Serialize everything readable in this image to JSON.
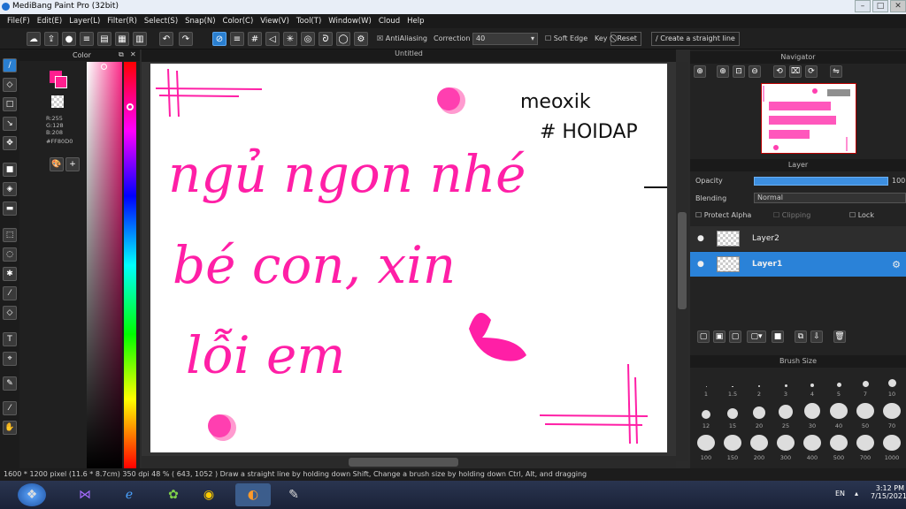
{
  "window": {
    "title": "MediBang Paint Pro (32bit)"
  },
  "menu": [
    "File(F)",
    "Edit(E)",
    "Layer(L)",
    "Filter(R)",
    "Select(S)",
    "Snap(N)",
    "Color(C)",
    "View(V)",
    "Tool(T)",
    "Window(W)",
    "Cloud",
    "Help"
  ],
  "toolbar": {
    "antialiasing_label": "AntiAliasing",
    "correction_label": "Correction",
    "correction_value": "40",
    "soft_edge_label": "Soft Edge",
    "key_label": "Key",
    "reset_label": "Reset",
    "straight_line_label": "Create a straight line"
  },
  "color_panel": {
    "title": "Color",
    "r": "R:255",
    "g": "G:128",
    "b": "B:208",
    "hex": "#FF80D0"
  },
  "canvas": {
    "tab": "Untitled",
    "text_lines": [
      "ngủ ngon nhé",
      "bé con, xin",
      "lỗi em"
    ],
    "signature": "meoxik",
    "hashtag": "# HOIDAP"
  },
  "navigator": {
    "title": "Navigator"
  },
  "layer_panel": {
    "title": "Layer",
    "opacity_label": "Opacity",
    "opacity_value": "100",
    "blending_label": "Blending",
    "blending_value": "Normal",
    "protect_alpha": "Protect Alpha",
    "clipping": "Clipping",
    "lock": "Lock",
    "layers": [
      "Layer2",
      "Layer1"
    ]
  },
  "brush_panel": {
    "title": "Brush Size",
    "sizes": [
      "1",
      "1.5",
      "2",
      "3",
      "4",
      "5",
      "7",
      "10",
      "12",
      "15",
      "20",
      "25",
      "30",
      "40",
      "50",
      "70",
      "100",
      "150",
      "200",
      "300",
      "400",
      "500",
      "700",
      "1000"
    ]
  },
  "status": {
    "text": "1600 * 1200 pixel  (11.6 * 8.7cm)  350 dpi  48 %  ( 643, 1052 )  Draw a straight line by holding down Shift, Change a brush size by holding down Ctrl, Alt, and dragging"
  },
  "taskbar": {
    "lang": "EN",
    "time": "3:12 PM",
    "date": "7/15/2021"
  },
  "colors": {
    "accent": "#2a7fd0",
    "ink": "#ff1fa6",
    "fg": "#ff2c8a"
  }
}
